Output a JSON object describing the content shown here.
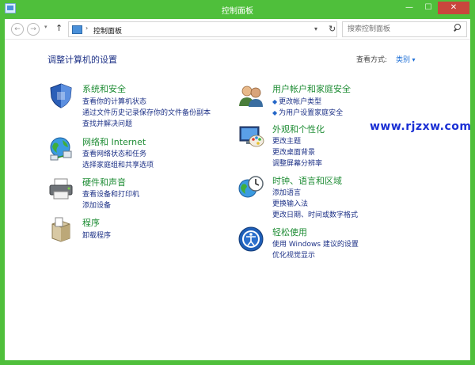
{
  "window": {
    "title": "控制面板"
  },
  "titlebar": {
    "minimize_glyph": "—",
    "maximize_glyph": "☐",
    "close_glyph": "✕"
  },
  "nav": {
    "back_glyph": "←",
    "forward_glyph": "→",
    "history_glyph": "▾",
    "up_glyph": "↑",
    "address_sep": "›",
    "address_text": "控制面板",
    "address_dropdown": "▾",
    "refresh_glyph": "↻",
    "search_placeholder": "搜索控制面板"
  },
  "main": {
    "heading": "调整计算机的设置",
    "view_by_label": "查看方式:",
    "view_mode": "类别",
    "left_column": [
      {
        "title": "系统和安全",
        "icon": "shield-icon",
        "links": [
          "查看你的计算机状态",
          "通过文件历史记录保存你的文件备份副本",
          "查找并解决问题"
        ]
      },
      {
        "title": "网络和 Internet",
        "icon": "network-globe-icon",
        "links": [
          "查看网络状态和任务",
          "选择家庭组和共享选项"
        ]
      },
      {
        "title": "硬件和声音",
        "icon": "printer-icon",
        "links": [
          "查看设备和打印机",
          "添加设备"
        ]
      },
      {
        "title": "程序",
        "icon": "programs-box-icon",
        "links": [
          "卸载程序"
        ]
      }
    ],
    "right_column": [
      {
        "title": "用户帐户和家庭安全",
        "icon": "users-icon",
        "links": [
          "更改帐户类型",
          "为用户设置家庭安全"
        ]
      },
      {
        "title": "外观和个性化",
        "icon": "monitor-palette-icon",
        "links": [
          "更改主题",
          "更改桌面背景",
          "调整屏幕分辨率"
        ]
      },
      {
        "title": "时钟、语言和区域",
        "icon": "clock-globe-icon",
        "links": [
          "添加语言",
          "更换输入法",
          "更改日期、时间或数字格式"
        ]
      },
      {
        "title": "轻松使用",
        "icon": "ease-of-access-icon",
        "links": [
          "使用 Windows 建议的设置",
          "优化视觉显示"
        ]
      }
    ]
  },
  "watermark": {
    "text": "www.rjzxw.com"
  },
  "colors": {
    "accent": "#4fbf3b",
    "link": "#1e3287",
    "category_title": "#1e8c34",
    "watermark": "#1a2fd4"
  }
}
